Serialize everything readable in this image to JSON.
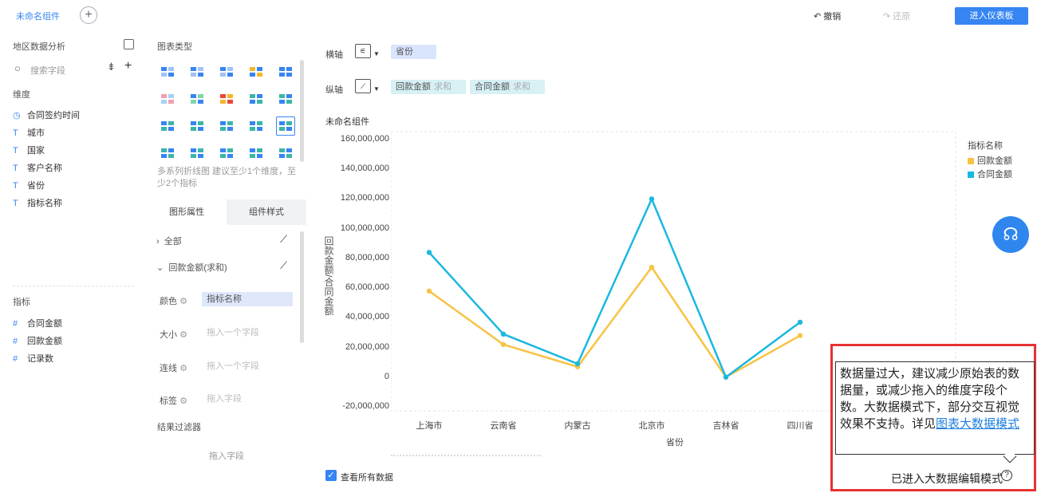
{
  "topbar": {
    "tab_title": "未命名组件",
    "add_tab": "+",
    "undo": "撤销",
    "redo": "还原",
    "enter_dashboard": "进入仪表板"
  },
  "datasource": {
    "title": "地区数据分析",
    "search_placeholder": "搜索字段",
    "dimension_label": "维度",
    "dimensions": [
      {
        "icon": "clock-icon",
        "glyph": "◷",
        "label": "合同签约时间"
      },
      {
        "icon": "text-icon",
        "glyph": "T",
        "label": "城市"
      },
      {
        "icon": "text-icon",
        "glyph": "T",
        "label": "国家"
      },
      {
        "icon": "text-icon",
        "glyph": "T",
        "label": "客户名称"
      },
      {
        "icon": "text-icon",
        "glyph": "T",
        "label": "省份"
      },
      {
        "icon": "text-icon",
        "glyph": "T",
        "label": "指标名称"
      }
    ],
    "measure_label": "指标",
    "measures": [
      {
        "icon": "hash-icon",
        "glyph": "#",
        "label": "合同金额"
      },
      {
        "icon": "hash-icon",
        "glyph": "#",
        "label": "回款金额"
      },
      {
        "icon": "hash-icon",
        "glyph": "#",
        "label": "记录数"
      }
    ]
  },
  "chart_types": {
    "title": "图表类型",
    "hint": "多系列折线图 建议至少1个维度，至少2个指标"
  },
  "props": {
    "tab_graph": "图形属性",
    "tab_style": "组件样式",
    "all_label": "全部",
    "series_label": "回款金额(求和)",
    "color_label": "颜色",
    "color_value": "指标名称",
    "size_label": "大小",
    "size_placeholder": "拖入一个字段",
    "line_label": "连线",
    "line_placeholder": "拖入一个字段",
    "tag_label": "标签",
    "tag_placeholder": "拖入字段",
    "filter_label": "结果过滤器",
    "filter_placeholder": "拖入字段"
  },
  "shelves": {
    "x_label": "横轴",
    "x_field": "省份",
    "y_label": "纵轴",
    "y_fields": [
      {
        "name": "回款金额",
        "agg": "求和"
      },
      {
        "name": "合同金额",
        "agg": "求和"
      }
    ]
  },
  "chart_data": {
    "type": "line",
    "title": "未命名组件",
    "xlabel": "省份",
    "ylabel": "回款金额/合同金额",
    "categories": [
      "上海市",
      "云南省",
      "内蒙古",
      "北京市",
      "吉林省",
      "四川省"
    ],
    "ylim": [
      -20000000,
      160000000
    ],
    "yticks": [
      "160,000,000",
      "140,000,000",
      "120,000,000",
      "100,000,000",
      "80,000,000",
      "60,000,000",
      "40,000,000",
      "20,000,000",
      "0",
      "-20,000,000"
    ],
    "legend_title": "指标名称",
    "legend_position": "right",
    "series": [
      {
        "name": "回款金额",
        "color": "#f7c343",
        "values": [
          58000000,
          22000000,
          7000000,
          74000000,
          0,
          28000000
        ]
      },
      {
        "name": "合同金额",
        "color": "#1ab8e0",
        "values": [
          84000000,
          29000000,
          9000000,
          120000000,
          0,
          37000000
        ]
      }
    ]
  },
  "footer": {
    "view_all_label": "查看所有数据"
  },
  "warning": {
    "text": "数据量过大，建议减少原始表的数据量，或减少拖入的维度字段个数。大数据模式下，部分交互视觉效果不支持。详见",
    "link": "图表大数据模式",
    "status": "已进入大数据编辑模式"
  }
}
